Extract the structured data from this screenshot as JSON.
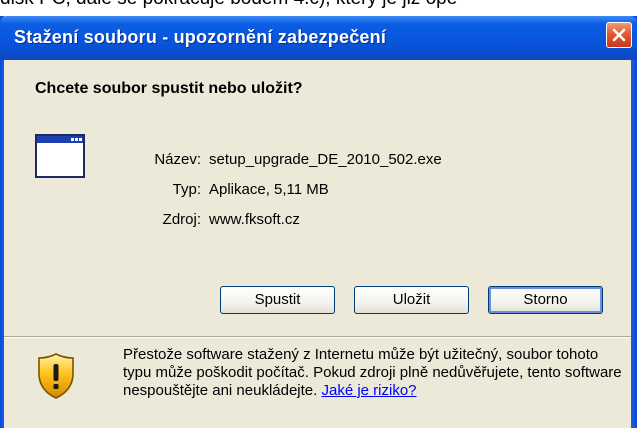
{
  "background_text": "disk PC, dále se pokračuje bodem 4.c), který je již ope",
  "dialog": {
    "title": "Stažení souboru - upozornění zabezpečení",
    "question": "Chcete soubor spustit nebo uložit?",
    "file": {
      "name_label": "Název:",
      "name_value": "setup_upgrade_DE_2010_502.exe",
      "type_label": "Typ:",
      "type_value": "Aplikace, 5,11 MB",
      "source_label": "Zdroj:",
      "source_value": "www.fksoft.cz"
    },
    "buttons": {
      "run": "Spustit",
      "save": "Uložit",
      "cancel": "Storno"
    },
    "warning": {
      "text": "Přestože software stažený z Internetu může být užitečný, soubor tohoto typu může poškodit počítač. Pokud zdroji plně nedůvěřujete, tento software nespouštějte ani neukládejte.",
      "link": "Jaké je riziko?"
    }
  },
  "icons": {
    "close": "close-icon",
    "file": "application-window-icon",
    "warning": "shield-warning-icon"
  },
  "colors": {
    "titlebar": "#0855dd",
    "dialog_bg": "#ece9d8",
    "close_button": "#e35a32",
    "link": "#0000ff"
  }
}
